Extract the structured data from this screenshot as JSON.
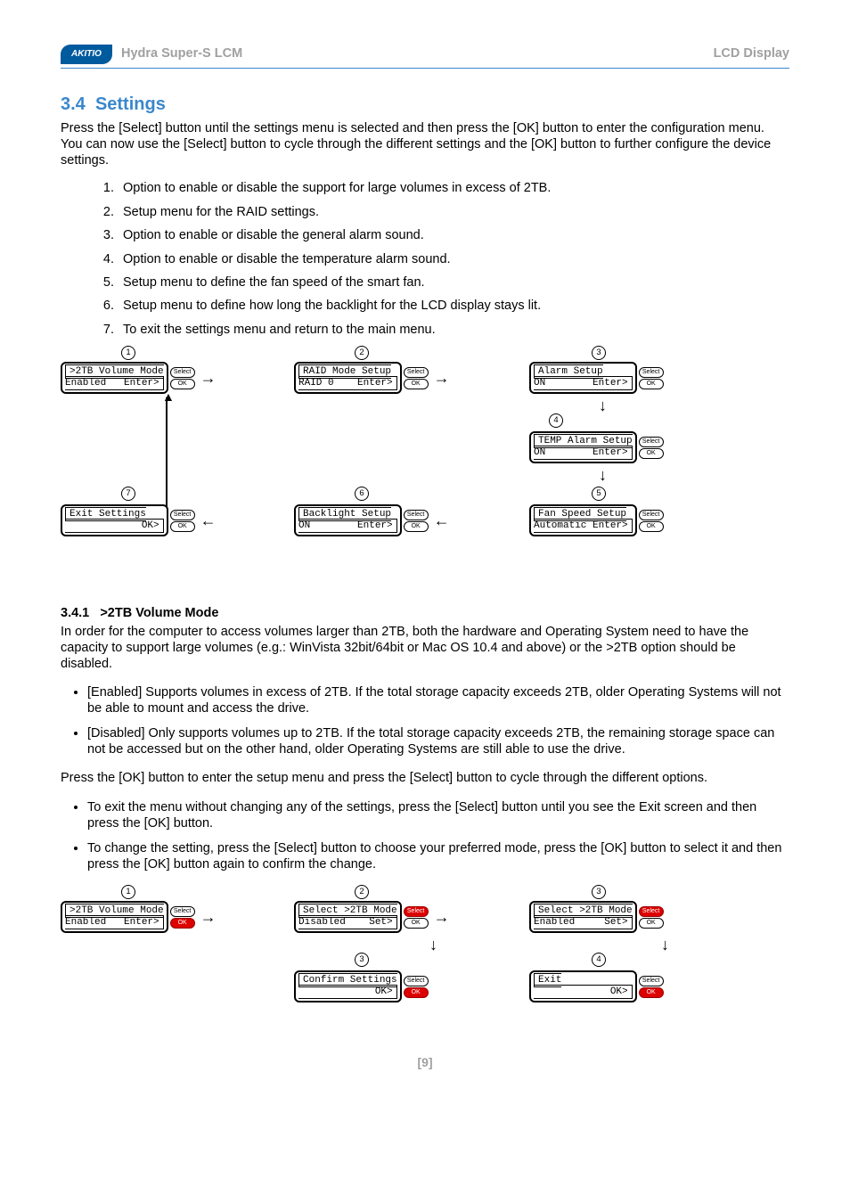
{
  "header": {
    "logo_text": "AKITIO",
    "doc_title_left": "Hydra Super-S LCM",
    "doc_title_right": "LCD Display"
  },
  "section": {
    "number": "3.4",
    "title": "Settings",
    "intro": "Press the [Select] button until the settings menu is selected and then press the [OK] button to enter the configuration menu. You can now use the [Select] button to cycle through the different settings and the [OK] button to further configure the device settings.",
    "options": [
      "Option to enable or disable the support for large volumes in excess of 2TB.",
      "Setup menu for the RAID settings.",
      "Option to enable or disable the general alarm sound.",
      "Option to enable or disable the temperature alarm sound.",
      "Setup menu to define the fan speed of the smart fan.",
      "Setup menu to define how long the backlight for the LCD display stays lit.",
      "To exit the settings menu and return to the main menu."
    ]
  },
  "diagram1": {
    "btn_select": "Select",
    "btn_ok": "OK",
    "lcd1": ">2TB Volume Mode\nEnabled   Enter>",
    "lcd2": "RAID Mode Setup\nRAID 0    Enter>",
    "lcd3": "Alarm Setup\nON        Enter>",
    "lcd4": "TEMP Alarm Setup\nON        Enter>",
    "lcd5": "Fan Speed Setup\nAutomatic Enter>",
    "lcd6": "Backlight Setup\nON        Enter>",
    "lcd7": "Exit Settings\n             OK>",
    "n1": "1",
    "n2": "2",
    "n3": "3",
    "n4": "4",
    "n5": "5",
    "n6": "6",
    "n7": "7"
  },
  "subsection": {
    "number": "3.4.1",
    "title": ">2TB Volume Mode",
    "intro": "In order for the computer to access volumes larger than 2TB, both the hardware and Operating System need to have the capacity to support large volumes (e.g.: WinVista 32bit/64bit or Mac OS 10.4 and above) or the >2TB option should be disabled.",
    "bullets1": [
      "[Enabled] Supports volumes in excess of 2TB. If the total storage capacity exceeds 2TB, older Operating Systems will not be able to mount and access the drive.",
      "[Disabled] Only supports volumes up to 2TB. If the total storage capacity exceeds 2TB, the remaining storage space can not be accessed but on the other hand, older Operating Systems are still able to use the drive."
    ],
    "para2": "Press the [OK] button to enter the setup menu and press the [Select] button to cycle through the different options.",
    "bullets2": [
      "To exit the menu without changing any of the settings, press the [Select] button until you see the Exit screen and then press the [OK] button.",
      "To change the setting, press the [Select] button to choose your preferred mode, press the [OK] button to select it and then press the [OK] button again to confirm the change."
    ]
  },
  "diagram2": {
    "lcd1": ">2TB Volume Mode\nEnabled   Enter>",
    "lcd2a": "Select >2TB Mode\nDisabled    Set>",
    "lcd2b": "Select >2TB Mode\nEnabled     Set>",
    "lcd3a": "Confirm Settings\n             OK>",
    "lcd4": "Exit\n             OK>",
    "n1": "1",
    "n2": "2",
    "n3": "3",
    "n4": "4",
    "btn_select": "Select",
    "btn_ok": "OK"
  },
  "footer": "[9]"
}
